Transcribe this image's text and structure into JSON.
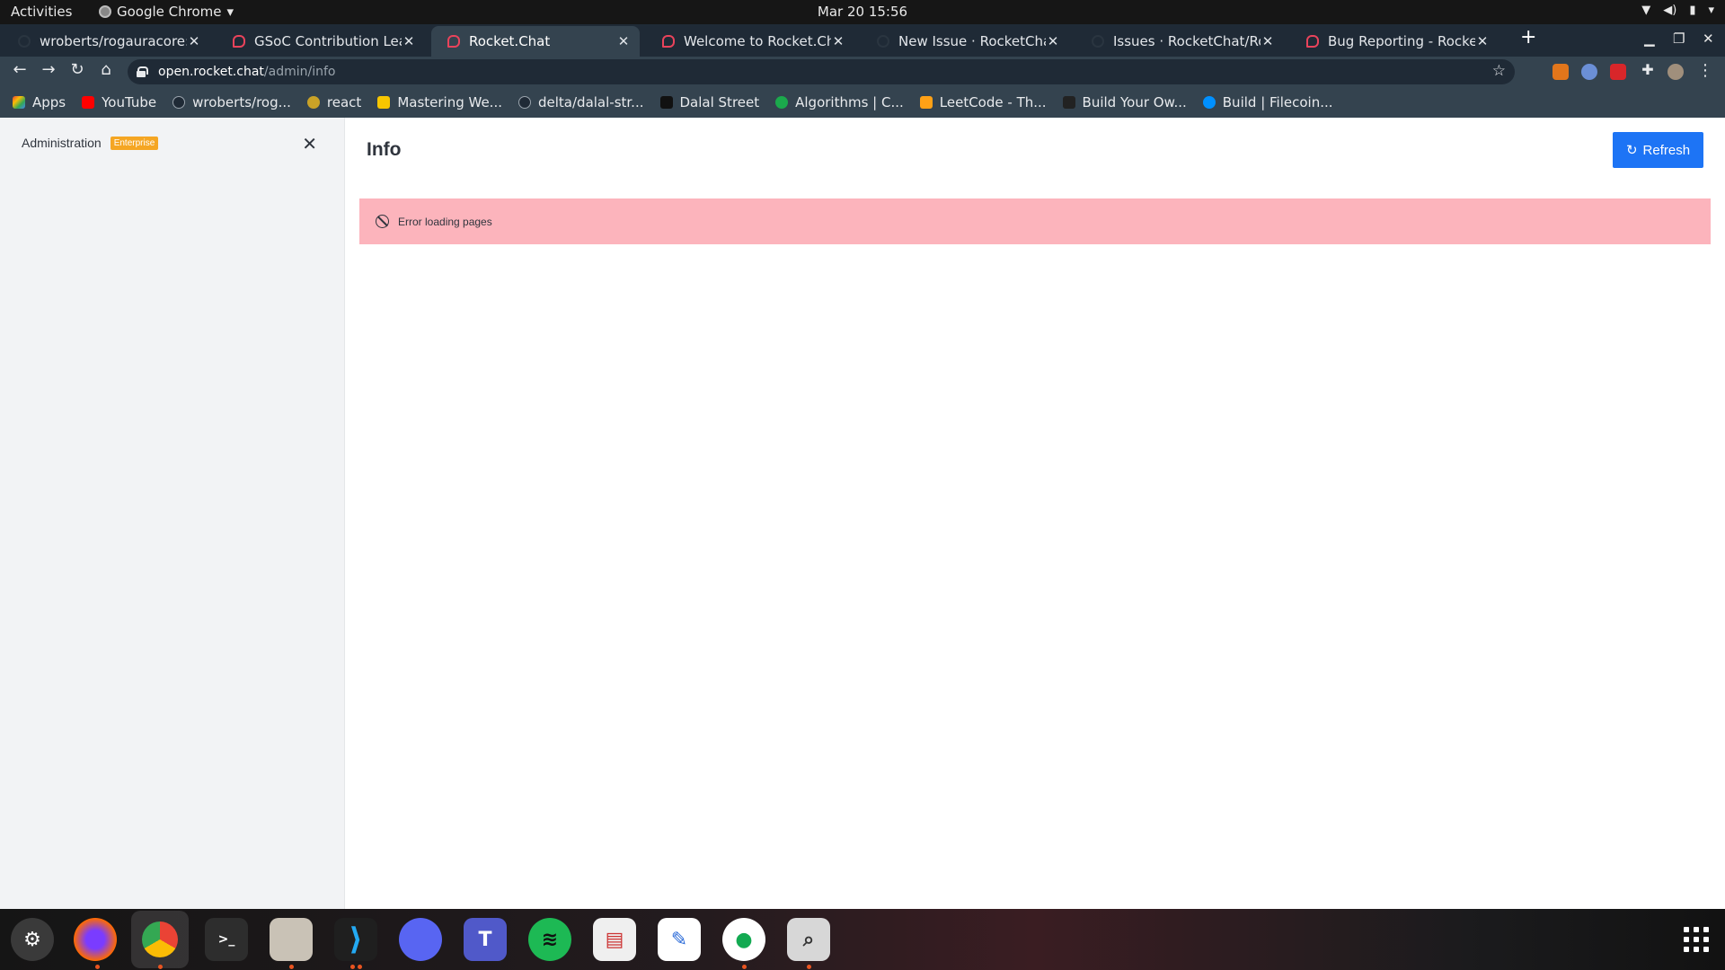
{
  "topbar": {
    "activities": "Activities",
    "app_name": "Google Chrome",
    "clock": "Mar 20  15:56"
  },
  "tabs": [
    {
      "title": "wroberts/rogauracore: R",
      "icon": "github-icon"
    },
    {
      "title": "GSoC Contribution Leade",
      "icon": "rocketchat-icon"
    },
    {
      "title": "Rocket.Chat",
      "icon": "rocketchat-icon"
    },
    {
      "title": "Welcome to Rocket.Chat",
      "icon": "rocketchat-icon"
    },
    {
      "title": "New Issue · RocketChat/R",
      "icon": "github-icon"
    },
    {
      "title": "Issues · RocketChat/Rocke",
      "icon": "github-icon"
    },
    {
      "title": "Bug Reporting - Rocket.Cl",
      "icon": "rocketchat-icon"
    }
  ],
  "address": {
    "host": "open.rocket.chat",
    "path": "/admin/info"
  },
  "bookmarks": [
    {
      "label": "Apps",
      "color": "#4285f4"
    },
    {
      "label": "YouTube",
      "color": "#ff0000"
    },
    {
      "label": "wroberts/rog...",
      "color": "#1f2a36"
    },
    {
      "label": "react",
      "color": "#c9a227"
    },
    {
      "label": "Mastering We...",
      "color": "#f7c600"
    },
    {
      "label": "delta/dalal-str...",
      "color": "#1f2a36"
    },
    {
      "label": "Dalal Street",
      "color": "#111111"
    },
    {
      "label": "Algorithms | C...",
      "color": "#1ba94c"
    },
    {
      "label": "LeetCode - Th...",
      "color": "#ffa116"
    },
    {
      "label": "Build Your Ow...",
      "color": "#222222"
    },
    {
      "label": "Build | Filecoin...",
      "color": "#0090ff"
    }
  ],
  "sidebar": {
    "title": "Administration",
    "badge": "Enterprise"
  },
  "main": {
    "title": "Info",
    "refresh_label": "Refresh",
    "error_message": "Error loading pages"
  },
  "colors": {
    "accent": "#1d74f5",
    "error_bg": "#fcb4bc",
    "badge": "#f5a623"
  }
}
